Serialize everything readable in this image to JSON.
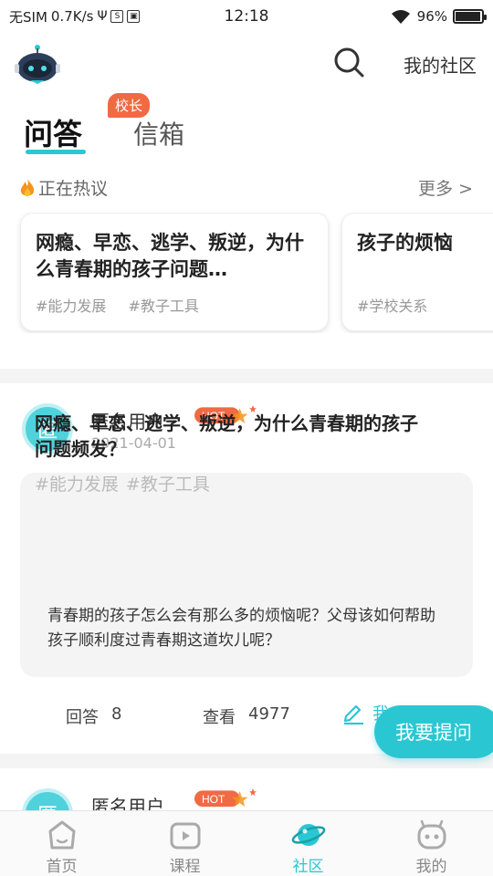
{
  "status_bar": {
    "carrier": "无SIM",
    "speed": "0.7K/s",
    "time": "12:18",
    "battery": "96%",
    "battery_level": 0.96
  },
  "header": {
    "community_link": "我的社区"
  },
  "tabs": [
    {
      "label": "问答",
      "active": true
    },
    {
      "label": "信箱",
      "badge": "校长"
    }
  ],
  "hot": {
    "title": "正在热议",
    "more": "更多 >",
    "cards": [
      {
        "title": "网瘾、早恋、逃学、叛逆，为什么青春期的孩子问题…",
        "tags": [
          "#能力发展",
          "#教子工具"
        ]
      },
      {
        "title": "孩子的烦恼",
        "tags": [
          "#学校关系"
        ]
      }
    ]
  },
  "post": {
    "avatar_char": "匿",
    "user": "匿名用户",
    "hot_badge": "HOT",
    "date": "2021-04-01",
    "question": "网瘾、早恋、逃学、叛逆，为什么青春期的孩子问题频发？",
    "tags": [
      "#能力发展",
      "#教子工具"
    ],
    "body": "青春期的孩子怎么会有那么多的烦恼呢？父母该如何帮助孩子顺利度过青春期这道坎儿呢？",
    "answers_label": "回答",
    "answers_count": "8",
    "views_label": "查看",
    "views_count": "4977",
    "answer_action": "我"
  },
  "post2": {
    "avatar_char": "匿",
    "user": "匿名用户",
    "hot_badge": "HOT"
  },
  "ask_button": "我要提问",
  "nav": [
    {
      "label": "首页",
      "icon": "home-icon"
    },
    {
      "label": "课程",
      "icon": "course-tv-icon"
    },
    {
      "label": "社区",
      "icon": "planet-icon",
      "active": true
    },
    {
      "label": "我的",
      "icon": "profile-face-icon"
    }
  ],
  "colors": {
    "accent": "#2ac7d3",
    "badge": "#f06a44"
  }
}
